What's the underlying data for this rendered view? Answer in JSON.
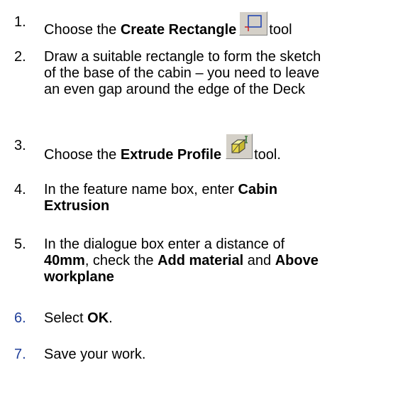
{
  "steps": [
    {
      "num": "1.",
      "pre": "Choose the ",
      "bold": "Create Rectangle",
      "icon": "create-rectangle-icon",
      "post": "tool"
    },
    {
      "num": "2.",
      "line1": "Draw a suitable rectangle to form the sketch",
      "line2": "of the base of the cabin – you need to leave",
      "line3": "an even gap around the edge of the Deck"
    },
    {
      "num": "3.",
      "pre": "Choose the ",
      "bold": "Extrude Profile",
      "icon": "extrude-profile-icon",
      "post": "tool."
    },
    {
      "num": "4.",
      "pre": "In the feature name box, enter ",
      "bold1": "Cabin",
      "bold2": "Extrusion"
    },
    {
      "num": "5.",
      "line1": "In the dialogue box enter a distance of",
      "bold_a": "40mm",
      "mid_a": ", check the ",
      "bold_b": "Add material",
      "mid_b": " and ",
      "bold_c": "Above",
      "bold_d": "workplane"
    },
    {
      "num": "6.",
      "pre": "Select ",
      "bold": "OK",
      "post": "."
    },
    {
      "num": "7.",
      "text": "Save your work."
    }
  ],
  "colors": {
    "text": "#000000",
    "blue_number": "#1f3e99"
  }
}
